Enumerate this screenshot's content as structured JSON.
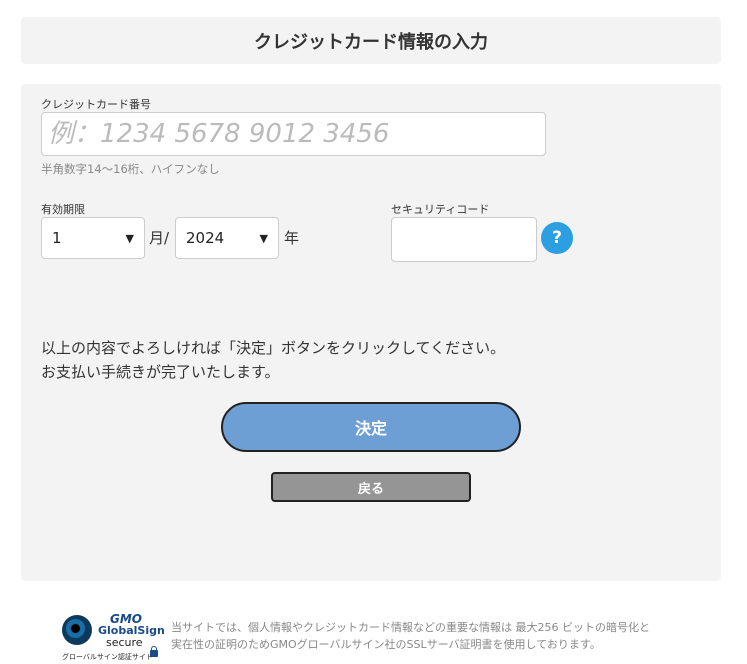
{
  "header": {
    "title": "クレジットカード情報の入力"
  },
  "card_number": {
    "label": "クレジットカード番号",
    "placeholder": "例：1234 5678 9012 3456",
    "hint": "半角数字14〜16桁、ハイフンなし"
  },
  "expiry": {
    "label": "有効期限",
    "month_value": "1",
    "month_unit": "月/",
    "year_value": "2024",
    "year_unit": "年"
  },
  "security": {
    "label": "セキュリティコード",
    "help_symbol": "?"
  },
  "message": {
    "line1": "以上の内容でよろしければ「決定」ボタンをクリックしてください。",
    "line2": "お支払い手続きが完了いたします。"
  },
  "buttons": {
    "submit": "決定",
    "back": "戻る"
  },
  "seal": {
    "brand": "GMO",
    "name": "GlobalSign",
    "secure": "secure",
    "caption": "グローバルサイン認証サイト"
  },
  "footer": {
    "line1": "当サイトでは、個人情報やクレジットカード情報などの重要な情報は 最大256 ビットの暗号化と",
    "line2": "実在性の証明のためGMOグローバルサイン社のSSLサーバ証明書を使用しております。"
  },
  "colors": {
    "submit": "#6d9ed4",
    "back": "#959595",
    "help": "#2b9fe0",
    "panel": "#f3f3f3"
  }
}
